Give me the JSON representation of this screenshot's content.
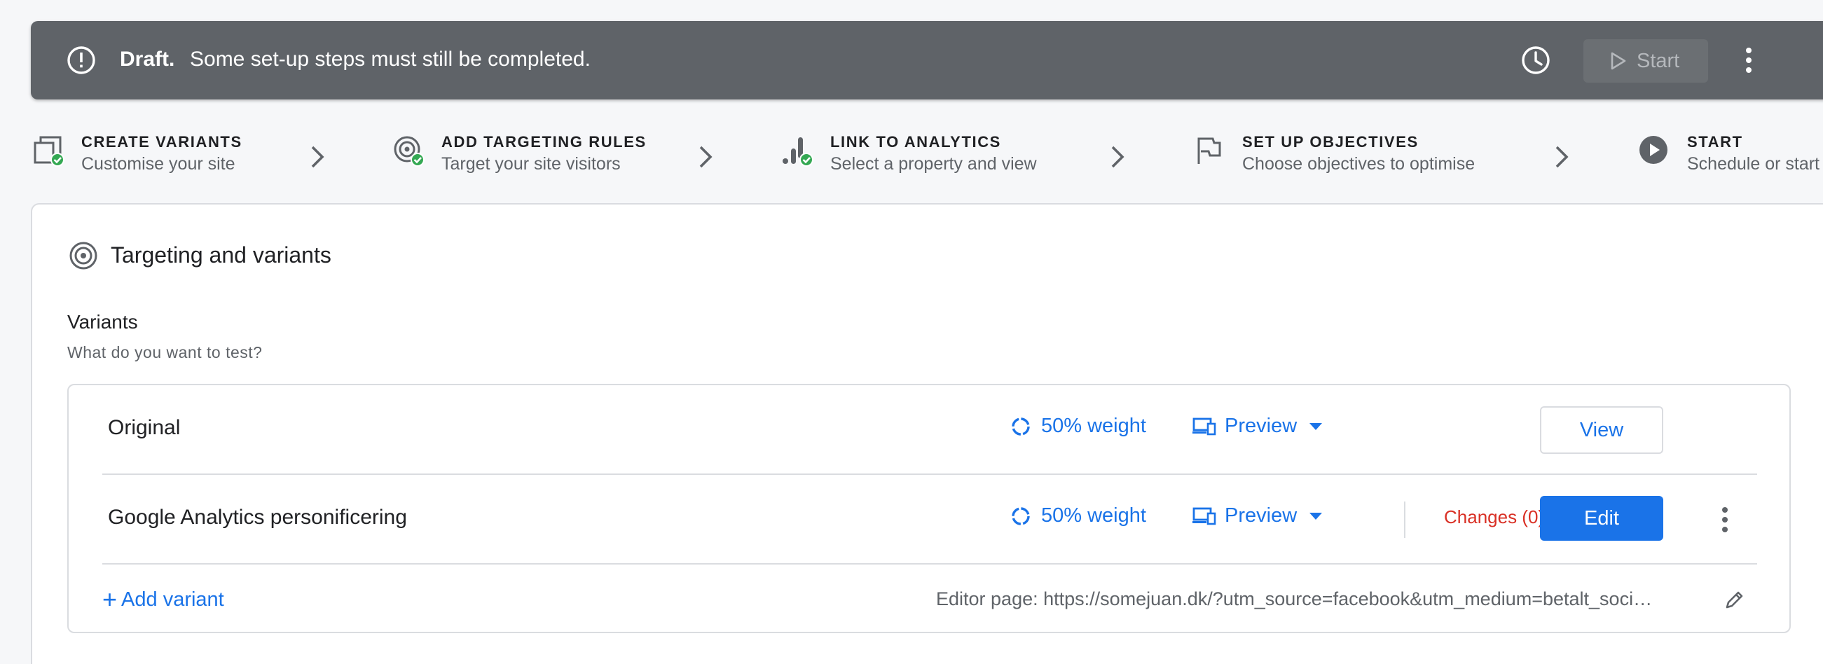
{
  "banner": {
    "status_label": "Draft.",
    "message": "Some set-up steps must still be completed.",
    "start_label": "Start",
    "icons": [
      "alert-circle-icon",
      "history-icon",
      "play-icon",
      "more-vert-icon"
    ]
  },
  "stepper": {
    "steps": [
      {
        "title": "CREATE VARIANTS",
        "subtitle": "Customise your site",
        "icon": "variants-icon",
        "done": true
      },
      {
        "title": "ADD TARGETING RULES",
        "subtitle": "Target your site visitors",
        "icon": "target-icon",
        "done": true
      },
      {
        "title": "LINK TO ANALYTICS",
        "subtitle": "Select a property and view",
        "icon": "analytics-icon",
        "done": true
      },
      {
        "title": "SET UP OBJECTIVES",
        "subtitle": "Choose objectives to optimise",
        "icon": "flag-icon",
        "done": false
      },
      {
        "title": "START",
        "subtitle": "Schedule or start",
        "icon": "play-circle-icon",
        "done": false
      }
    ],
    "colors": {
      "check": "#34a853"
    }
  },
  "card": {
    "title": "Targeting and variants",
    "variants_heading": "Variants",
    "variants_subheading": "What do you want to test?",
    "variants": [
      {
        "name": "Original",
        "weight": "50% weight",
        "preview_label": "Preview",
        "action_label": "View"
      },
      {
        "name": "Google Analytics personificering",
        "weight": "50% weight",
        "preview_label": "Preview",
        "changes_label": "Changes (0)",
        "action_label": "Edit"
      }
    ],
    "add_variant_label": "Add variant",
    "editor_page": "Editor page: https://somejuan.dk/?utm_source=facebook&utm_medium=betalt_soci…"
  },
  "colors": {
    "banner_bg": "#5f6368",
    "accent": "#1a73e8",
    "changes": "#d93025",
    "success": "#34a853"
  }
}
